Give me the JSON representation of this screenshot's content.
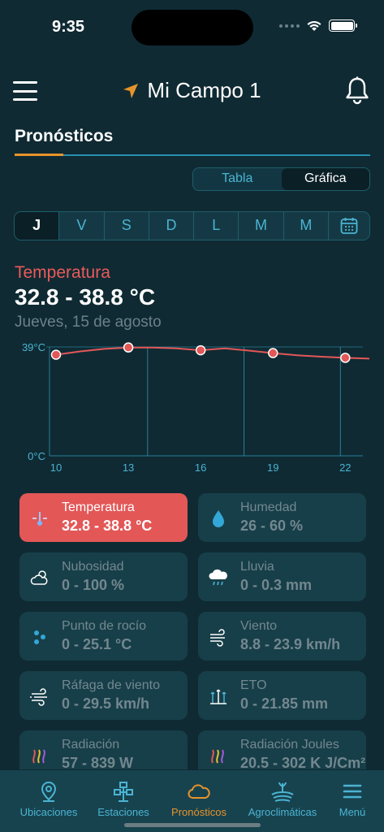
{
  "status_bar": {
    "time": "9:35"
  },
  "header": {
    "title": "Mi Campo 1"
  },
  "section": {
    "tab_label": "Pronósticos"
  },
  "view_toggle": {
    "table_label": "Tabla",
    "chart_label": "Gráfica",
    "selected": "Gráfica"
  },
  "days": [
    {
      "label": "J",
      "active": true
    },
    {
      "label": "V",
      "active": false
    },
    {
      "label": "S",
      "active": false
    },
    {
      "label": "D",
      "active": false
    },
    {
      "label": "L",
      "active": false
    },
    {
      "label": "M",
      "active": false
    },
    {
      "label": "M",
      "active": false
    }
  ],
  "headline": {
    "metric": "Temperatura",
    "range": "32.8 - 38.8 °C",
    "date": "Jueves, 15 de agosto"
  },
  "chart_data": {
    "type": "line",
    "y_tick_labels": [
      "39°C",
      "0°C"
    ],
    "ylim": [
      0,
      39
    ],
    "x_tick_labels": [
      "10",
      "13",
      "16",
      "19",
      "22"
    ],
    "xlim": [
      10,
      23
    ],
    "series": [
      {
        "x": [
          10,
          11,
          12,
          13,
          14,
          15,
          16,
          17,
          18,
          19,
          20,
          21,
          22,
          23
        ],
        "y": [
          36.2,
          37.4,
          38.3,
          38.8,
          38.8,
          38.5,
          37.8,
          38.5,
          37.7,
          36.8,
          36.0,
          35.5,
          35.1,
          34.8
        ]
      }
    ],
    "markers_x": [
      10,
      13,
      16,
      19,
      22
    ],
    "markers_y": [
      36.2,
      38.8,
      37.8,
      36.8,
      35.1
    ],
    "grid": true,
    "line_color": "#e35757",
    "marker_color": "#ffffff"
  },
  "cards": [
    {
      "id": "temperatura",
      "label": "Temperatura",
      "value": "32.8 - 38.8 °C",
      "icon": "thermometer-icon",
      "active": true
    },
    {
      "id": "humedad",
      "label": "Humedad",
      "value": "26 - 60 %",
      "icon": "droplet-icon",
      "active": false
    },
    {
      "id": "nubosidad",
      "label": "Nubosidad",
      "value": "0 - 100 %",
      "icon": "cloud-sun-icon",
      "active": false
    },
    {
      "id": "lluvia",
      "label": "Lluvia",
      "value": "0 - 0.3 mm",
      "icon": "rain-cloud-icon",
      "active": false
    },
    {
      "id": "rocio",
      "label": "Punto de rocío",
      "value": "0 - 25.1 °C",
      "icon": "dew-drops-icon",
      "active": false
    },
    {
      "id": "viento",
      "label": "Viento",
      "value": "8.8 - 23.9 km/h",
      "icon": "wind-icon",
      "active": false
    },
    {
      "id": "rafaga",
      "label": "Ráfaga de viento",
      "value": "0 - 29.5 km/h",
      "icon": "gust-icon",
      "active": false
    },
    {
      "id": "eto",
      "label": "ETO",
      "value": "0 - 21.85 mm",
      "icon": "evapotranspiration-icon",
      "active": false
    },
    {
      "id": "radiacion",
      "label": "Radiación",
      "value": "57 - 839 W",
      "icon": "radiation-icon",
      "active": false
    },
    {
      "id": "radiacion-joules",
      "label": "Radiación Joules",
      "value": "20.5 - 302 K J/Cm²",
      "icon": "radiation-icon",
      "active": false
    }
  ],
  "bottom_nav": [
    {
      "label": "Ubicaciones",
      "icon": "location-pin-icon",
      "active": false
    },
    {
      "label": "Estaciones",
      "icon": "station-icon",
      "active": false
    },
    {
      "label": "Pronósticos",
      "icon": "cloud-icon",
      "active": true
    },
    {
      "label": "Agroclimáticas",
      "icon": "field-icon",
      "active": false
    },
    {
      "label": "Menú",
      "icon": "menu-icon",
      "active": false
    }
  ],
  "colors": {
    "background": "#0f2a33",
    "accent_orange": "#e8932a",
    "accent_blue": "#4bb4d2",
    "active_red": "#e35757",
    "card_bg": "#173f49"
  }
}
